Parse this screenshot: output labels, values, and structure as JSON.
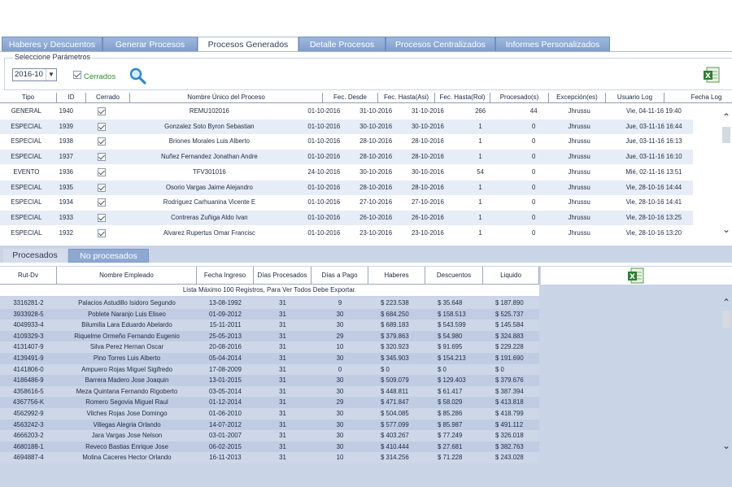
{
  "tabs": [
    {
      "label": "Haberes y Descuentos",
      "active": false
    },
    {
      "label": "Generar Procesos",
      "active": false
    },
    {
      "label": "Procesos Generados",
      "active": true
    },
    {
      "label": "Detalle Procesos",
      "active": false
    },
    {
      "label": "Procesos Centralizados",
      "active": false
    },
    {
      "label": "Informes Personalizados",
      "active": false
    }
  ],
  "params": {
    "legend": "Seleccione Parámetros",
    "period_value": "2016-10",
    "cerrados_label": "Cerrados",
    "cerrados_checked": true
  },
  "processes": {
    "columns": [
      "Tipo",
      "ID",
      "Cerrado",
      "Nombre Único del Proceso",
      "Fec. Desde",
      "Fec. Hasta(Asi)",
      "Fec. Hasta(Rol)",
      "Procesado(s)",
      "Excepción(es)",
      "Usuario Log",
      "Fecha Log"
    ],
    "rows": [
      [
        "GENERAL",
        "1940",
        true,
        "REMU102016",
        "01-10-2016",
        "31-10-2016",
        "31-10-2016",
        "266",
        "44",
        "Jhrussu",
        "Vie, 04-11-16 19:40"
      ],
      [
        "ESPECIAL",
        "1939",
        true,
        "Gonzalez Soto Byron Sebastian",
        "01-10-2016",
        "30-10-2016",
        "30-10-2016",
        "1",
        "0",
        "Jhrussu",
        "Jue, 03-11-16 16:44"
      ],
      [
        "ESPECIAL",
        "1938",
        true,
        "Briones Morales Luis Alberto",
        "01-10-2016",
        "28-10-2016",
        "28-10-2016",
        "1",
        "0",
        "Jhrussu",
        "Jue, 03-11-16 16:13"
      ],
      [
        "ESPECIAL",
        "1937",
        true,
        "Nuñez Fernandez Jonathan Andre",
        "01-10-2016",
        "28-10-2016",
        "28-10-2016",
        "1",
        "0",
        "Jhrussu",
        "Jue, 03-11-16 16:10"
      ],
      [
        "EVENTO",
        "1936",
        true,
        "TFV301016",
        "24-10-2016",
        "30-10-2016",
        "30-10-2016",
        "54",
        "0",
        "Jhrussu",
        "Mié, 02-11-16 13:51"
      ],
      [
        "ESPECIAL",
        "1935",
        true,
        "Osorio Vargas Jaime Alejandro",
        "01-10-2016",
        "28-10-2016",
        "28-10-2016",
        "1",
        "0",
        "Jhrussu",
        "Vie, 28-10-16 14:44"
      ],
      [
        "ESPECIAL",
        "1934",
        true,
        "Rodriguez Carhuanina Vicente E",
        "01-10-2016",
        "27-10-2016",
        "27-10-2016",
        "1",
        "0",
        "Jhrussu",
        "Vie, 28-10-16 14:41"
      ],
      [
        "ESPECIAL",
        "1933",
        true,
        "Contreras Zuñiga Aldo Ivan",
        "01-10-2016",
        "26-10-2016",
        "26-10-2016",
        "1",
        "0",
        "Jhrussu",
        "Vie, 28-10-16 13:25"
      ],
      [
        "ESPECIAL",
        "1932",
        true,
        "Alvarez Rupertus Omar Francisc",
        "01-10-2016",
        "23-10-2016",
        "23-10-2016",
        "1",
        "0",
        "Jhrussu",
        "Vie, 28-10-16 13:20"
      ]
    ]
  },
  "bottom_tabs": [
    {
      "label": "Procesados",
      "active": true
    },
    {
      "label": "No procesados",
      "active": false
    }
  ],
  "employees": {
    "columns": [
      "Rut-Dv",
      "Nombre Empleado",
      "Fecha Ingreso",
      "Días Procesados",
      "Días a Pago",
      "Haberes",
      "Descuentos",
      "Liquido"
    ],
    "notice": "Lista Máximo 100 Registros, Para Ver Todos Debe Exportar.",
    "rows": [
      [
        "3316281-2",
        "Palacios Astudillo Isidoro Segundo",
        "13-08-1992",
        "31",
        "9",
        "$ 223.538",
        "$ 35.648",
        "$ 187.890"
      ],
      [
        "3933928-5",
        "Poblete Naranjo Luis Eliseo",
        "01-09-2012",
        "31",
        "30",
        "$ 684.250",
        "$ 158.513",
        "$ 525.737"
      ],
      [
        "4049933-4",
        "Bilumilla Lara Eduardo Abelardo",
        "15-11-2011",
        "31",
        "30",
        "$ 689.183",
        "$ 543.599",
        "$ 145.584"
      ],
      [
        "4109329-3",
        "Riquelme Ormeño Fernando Eugenio",
        "25-05-2013",
        "31",
        "29",
        "$ 379.863",
        "$ 54.980",
        "$ 324.883"
      ],
      [
        "4131407-9",
        "Silva Perez Hernan Oscar",
        "20-08-2016",
        "31",
        "10",
        "$ 320.923",
        "$ 91.695",
        "$ 229.228"
      ],
      [
        "4139491-9",
        "Pino Torres Luis Alberto",
        "05-04-2014",
        "31",
        "30",
        "$ 345.903",
        "$ 154.213",
        "$ 191.690"
      ],
      [
        "4141806-0",
        "Ampuero Rojas Miguel Sigifredo",
        "17-08-2009",
        "31",
        "0",
        "$ 0",
        "$ 0",
        "$ 0"
      ],
      [
        "4186486-9",
        "Barrera Madero Jose Joaquin",
        "13-01-2015",
        "31",
        "30",
        "$ 509.079",
        "$ 129.403",
        "$ 379.676"
      ],
      [
        "4358616-5",
        "Meza Quintana Fernando Rigoberto",
        "03-05-2014",
        "31",
        "30",
        "$ 448.811",
        "$ 61.417",
        "$ 387.394"
      ],
      [
        "4367756-K",
        "Romero Segovia Miguel Raul",
        "01-12-2014",
        "31",
        "29",
        "$ 471.847",
        "$ 58.029",
        "$ 413.818"
      ],
      [
        "4562992-9",
        "Vilches Rojas Jose Domingo",
        "01-06-2010",
        "31",
        "30",
        "$ 504.085",
        "$ 85.286",
        "$ 418.799"
      ],
      [
        "4563242-3",
        "Villegas Alegria Orlando",
        "14-07-2012",
        "31",
        "30",
        "$ 577.099",
        "$ 85.987",
        "$ 491.112"
      ],
      [
        "4666203-2",
        "Jara Vargas Jose Nelson",
        "03-01-2007",
        "31",
        "30",
        "$ 403.267",
        "$ 77.249",
        "$ 326.018"
      ],
      [
        "4680188-1",
        "Reveco Bastias Enrique Jose",
        "06-02-2015",
        "31",
        "30",
        "$ 410.444",
        "$ 27.681",
        "$ 382.763"
      ],
      [
        "4694887-4",
        "Molina Caceres Hector Orlando",
        "16-11-2013",
        "31",
        "10",
        "$ 314.256",
        "$ 71.228",
        "$ 243.028"
      ]
    ]
  }
}
